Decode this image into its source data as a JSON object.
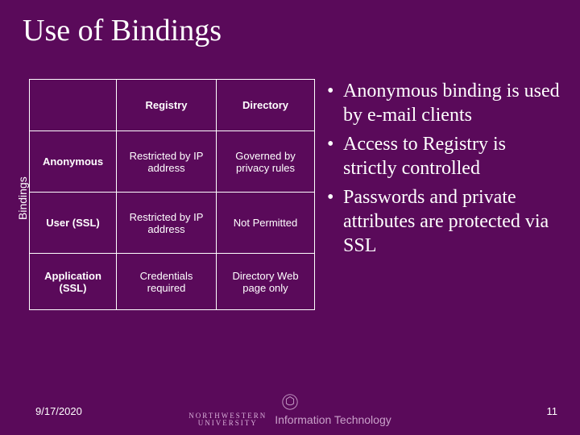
{
  "title": "Use of Bindings",
  "side_label": "Bindings",
  "table": {
    "headers": {
      "col0": "",
      "col1": "Registry",
      "col2": "Directory"
    },
    "rows": [
      {
        "label": "Anonymous",
        "registry": "Restricted by IP address",
        "directory": "Governed by privacy rules"
      },
      {
        "label": "User (SSL)",
        "registry": "Restricted by IP address",
        "directory": "Not Permitted"
      },
      {
        "label": "Application (SSL)",
        "registry": "Credentials required",
        "directory": "Directory Web page only"
      }
    ]
  },
  "bullets": [
    "Anonymous binding is used by e-mail clients",
    "Access to Registry is strictly controlled",
    "Passwords and private attributes are protected via SSL"
  ],
  "footer": {
    "date": "9/17/2020",
    "university_top": "NORTHWESTERN",
    "university_bottom": "UNIVERSITY",
    "department": "Information Technology",
    "page_number": "11"
  }
}
